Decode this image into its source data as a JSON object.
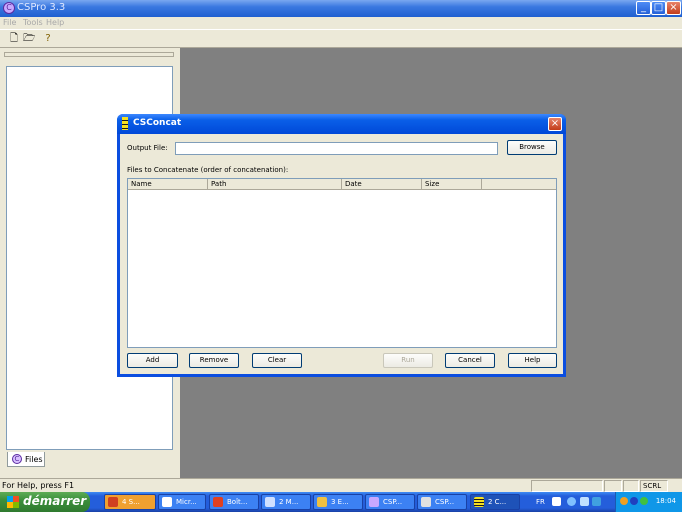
{
  "app": {
    "title": "CSPro 3.3",
    "title_icon": "cspro-logo-icon",
    "menu": [
      "File",
      "Tools",
      "Help"
    ],
    "toolbar_icons": [
      "new-file-icon",
      "open-folder-icon",
      "help-pointer-icon"
    ]
  },
  "left_pane": {
    "tab_label": "Files"
  },
  "status": {
    "text": "For Help, press F1",
    "scrl": "SCRL"
  },
  "dialog": {
    "title": "CSConcat",
    "output_label": "Output File:",
    "output_value": "",
    "browse": "Browse",
    "files_label": "Files to Concatenate (order of concatenation):",
    "columns": [
      "Name",
      "Path",
      "Date",
      "Size"
    ],
    "rows": [],
    "buttons": {
      "add": "Add",
      "remove": "Remove",
      "clear": "Clear",
      "run": "Run",
      "cancel": "Cancel",
      "help": "Help"
    }
  },
  "taskbar": {
    "start": "démarrer",
    "tasks": [
      "4 S...",
      "Micr...",
      "Boît...",
      "2 M...",
      "3 E...",
      "CSP...",
      "CSP...",
      "2 C..."
    ],
    "lang": "FR",
    "clock": "18:04"
  },
  "colors": {
    "titlebar_blue": "#0a5fe8",
    "taskbar_blue": "#245edb",
    "start_green": "#3c8f3c",
    "dialog_face": "#ece9d8"
  }
}
